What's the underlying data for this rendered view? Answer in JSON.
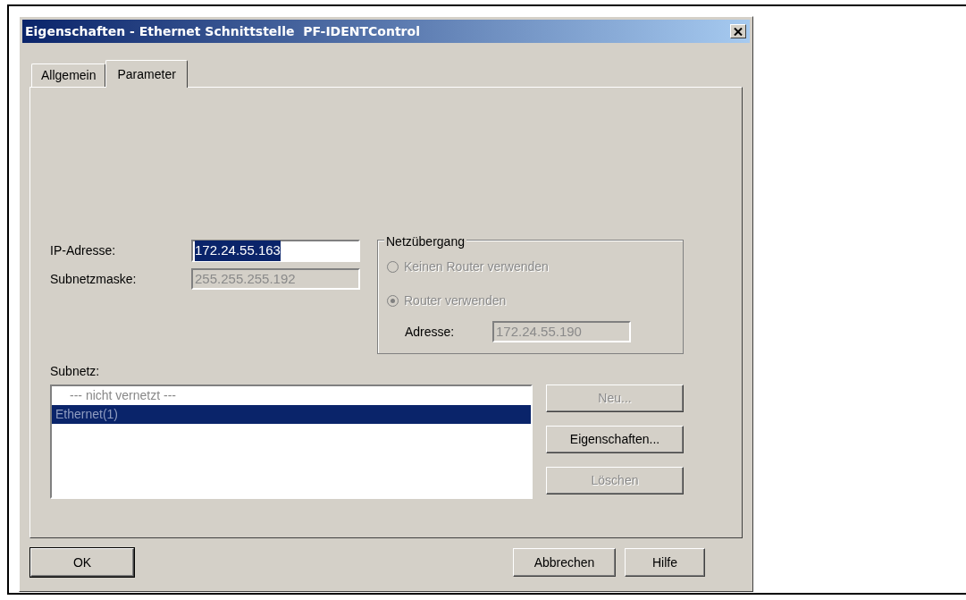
{
  "window": {
    "title": "Eigenschaften - Ethernet Schnittstelle  PF-IDENTControl"
  },
  "tabs": [
    {
      "label": "Allgemein",
      "selected": false
    },
    {
      "label": "Parameter",
      "selected": true
    }
  ],
  "fields": [
    {
      "label": "IP-Adresse:",
      "value": "172.24.55.163",
      "selected": true,
      "disabled": false
    },
    {
      "label": "Subnetzmaske:",
      "value": "255.255.255.192",
      "selected": false,
      "disabled": true
    }
  ],
  "gateway": {
    "title": "Netzübergang",
    "options": [
      {
        "label": "Keinen Router verwenden",
        "selected": false,
        "disabled": true
      },
      {
        "label": "Router verwenden",
        "selected": true,
        "disabled": true
      }
    ],
    "address": {
      "label": "Adresse:",
      "value": "172.24.55.190",
      "disabled": true
    }
  },
  "subnet": {
    "label": "Subnetz:",
    "items": [
      {
        "label": "--- nicht vernetzt ---",
        "selected": false
      },
      {
        "label": "Ethernet(1)",
        "selected": true
      }
    ],
    "buttons": [
      {
        "label": "Neu...",
        "disabled": true
      },
      {
        "label": "Eigenschaften...",
        "disabled": false
      },
      {
        "label": "Löschen",
        "disabled": true
      }
    ]
  },
  "footer_buttons": [
    {
      "label": "OK",
      "default": true
    },
    {
      "label": "Abbrechen",
      "default": false
    },
    {
      "label": "Hilfe",
      "default": false
    }
  ]
}
